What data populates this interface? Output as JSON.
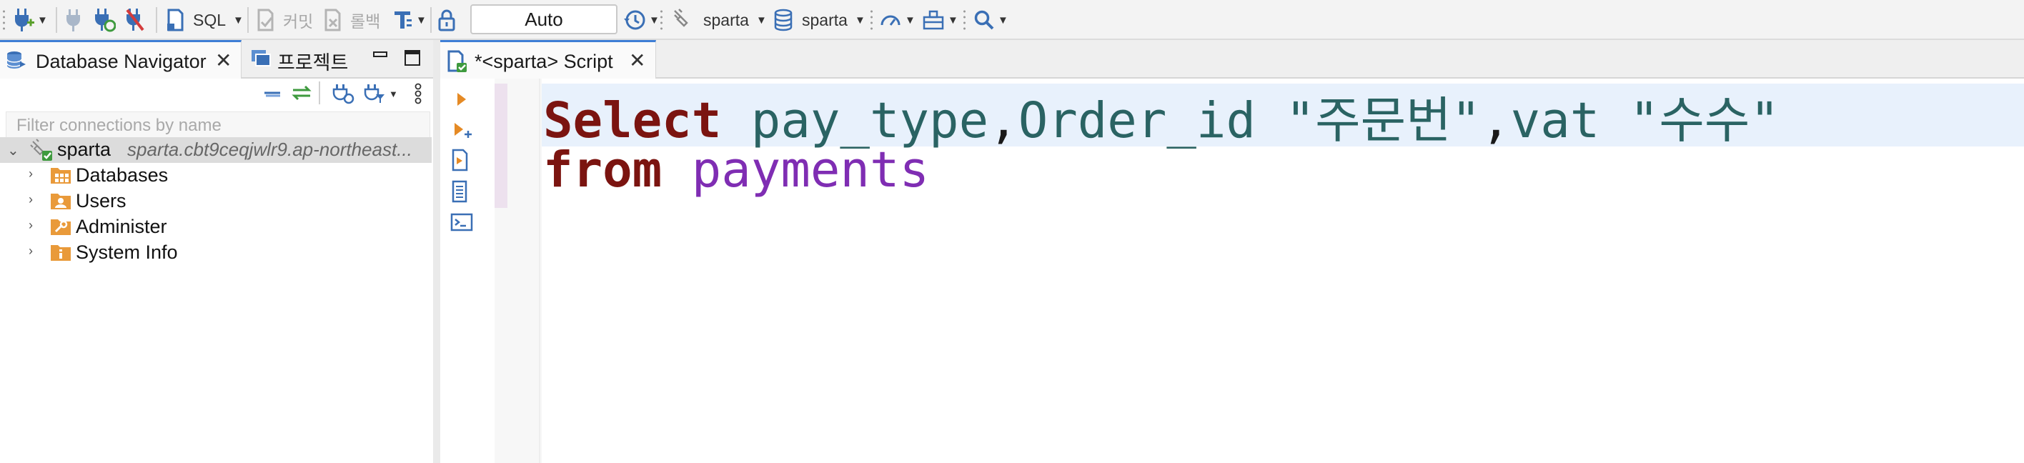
{
  "toolbar": {
    "sql_label": "SQL",
    "commit_label": "커밋",
    "rollback_label": "롤백",
    "transaction_mode": "Auto",
    "datasource_label": "sparta",
    "schema_label": "sparta"
  },
  "left_panel": {
    "tabs": [
      {
        "label": "Database Navigator",
        "active": true
      },
      {
        "label": "프로젝트",
        "active": false
      }
    ],
    "filter_placeholder": "Filter connections by name",
    "connection": {
      "name": "sparta",
      "host": "sparta.cbt9ceqjwlr9.ap-northeast..."
    },
    "tree": [
      {
        "label": "Databases"
      },
      {
        "label": "Users"
      },
      {
        "label": "Administer"
      },
      {
        "label": "System Info"
      }
    ]
  },
  "editor": {
    "tab_title": "*<sparta> Script",
    "code": {
      "line1": {
        "kw": "Select",
        "c1": "pay_type",
        "comma1": ",",
        "c2": "Order_id",
        "s1": "\"주문번\"",
        "comma2": ",",
        "c3": "vat",
        "s2": "\"수수\""
      },
      "line2": {
        "kw": "from",
        "table": "payments"
      }
    }
  },
  "colors": {
    "accent": "#3f7fd6",
    "keyword": "#7b1410",
    "identifier": "#2a6363",
    "table": "#7f2db3",
    "current_line": "#e8f1fc"
  }
}
